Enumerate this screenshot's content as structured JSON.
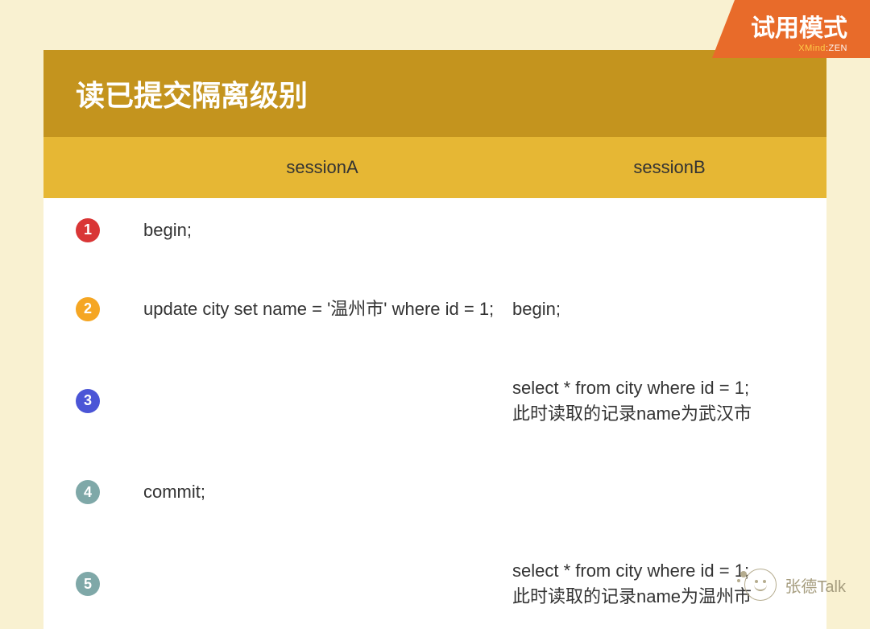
{
  "trial": {
    "title": "试用模式",
    "sub_accent": "XMind",
    "sub_sep": ":",
    "sub_tail": "ZEN"
  },
  "header": {
    "title": "读已提交隔离级别",
    "colA": "sessionA",
    "colB": "sessionB"
  },
  "rows": [
    {
      "num": "1",
      "badgeClass": "b1",
      "a": "begin;",
      "b": ""
    },
    {
      "num": "2",
      "badgeClass": "b2",
      "a": "update city set name = '温州市' where id = 1;",
      "b": "begin;"
    },
    {
      "num": "3",
      "badgeClass": "b3",
      "a": "",
      "b": "select * from city where id = 1;\n此时读取的记录name为武汉市"
    },
    {
      "num": "4",
      "badgeClass": "b4",
      "a": "commit;",
      "b": ""
    },
    {
      "num": "5",
      "badgeClass": "b5",
      "a": "",
      "b": "select * from city where id = 1;\n此时读取的记录name为温州市"
    }
  ],
  "watermark": {
    "text": "张德Talk"
  }
}
